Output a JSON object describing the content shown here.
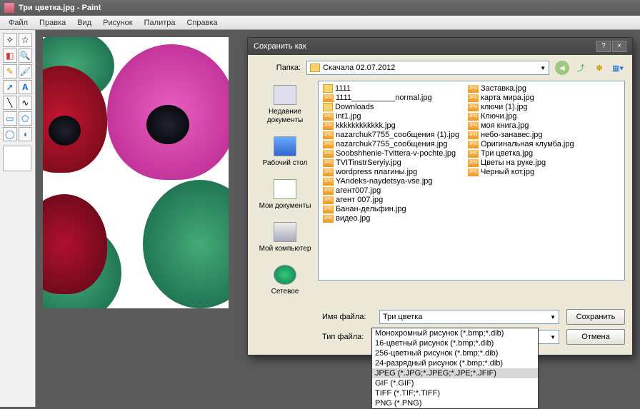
{
  "app": {
    "title": "Три цветка.jpg - Paint"
  },
  "menu": {
    "items": [
      "Файл",
      "Правка",
      "Вид",
      "Рисунок",
      "Палитра",
      "Справка"
    ]
  },
  "dialog": {
    "title": "Сохранить как",
    "help_symbol": "?",
    "close_symbol": "×",
    "folder_label": "Папка:",
    "folder_value": "Скачала 02.07.2012",
    "places": {
      "recent": "Недавние документы",
      "desktop": "Рабочий стол",
      "docs": "Мои документы",
      "computer": "Мой компьютер",
      "network": "Сетевое"
    },
    "files_col1": [
      {
        "name": "1111",
        "type": "folder"
      },
      {
        "name": "1111__________normal.jpg",
        "type": "jpg"
      },
      {
        "name": "Downloads",
        "type": "folder"
      },
      {
        "name": "int1.jpg",
        "type": "jpg"
      },
      {
        "name": "kkkkkkkkkkkk.jpg",
        "type": "jpg"
      },
      {
        "name": "nazarchuk7755_сообщения (1).jpg",
        "type": "jpg"
      },
      {
        "name": "nazarchuk7755_сообщения.jpg",
        "type": "jpg"
      },
      {
        "name": "Soobshhenie-Tvittera-v-pochte.jpg",
        "type": "jpg"
      },
      {
        "name": "TVITinstrSeryiy.jpg",
        "type": "jpg"
      },
      {
        "name": "wordpress плагины.jpg",
        "type": "jpg"
      },
      {
        "name": "YAndeks-naydetsya-vse.jpg",
        "type": "jpg"
      },
      {
        "name": "агент007.jpg",
        "type": "jpg"
      },
      {
        "name": "агент 007.jpg",
        "type": "jpg"
      },
      {
        "name": "Банан-дельфин.jpg",
        "type": "jpg"
      },
      {
        "name": "видео.jpg",
        "type": "jpg"
      }
    ],
    "files_col2": [
      {
        "name": "Заставка.jpg",
        "type": "jpg"
      },
      {
        "name": "карта мира.jpg",
        "type": "jpg"
      },
      {
        "name": "ключи (1).jpg",
        "type": "jpg"
      },
      {
        "name": "Ключи.jpg",
        "type": "jpg"
      },
      {
        "name": "моя книга.jpg",
        "type": "jpg"
      },
      {
        "name": "небо-занавес.jpg",
        "type": "jpg"
      },
      {
        "name": "Оригинальная клумба.jpg",
        "type": "jpg"
      },
      {
        "name": "Три цветка.jpg",
        "type": "jpg"
      },
      {
        "name": "Цветы на руке.jpg",
        "type": "jpg"
      },
      {
        "name": "Черный кот.jpg",
        "type": "jpg"
      }
    ],
    "filename_label": "Имя файла:",
    "filename_value": "Три цветка",
    "filetype_label": "Тип файла:",
    "filetype_value": "JPEG (*.JPG;*.JPEG;*.JPE;*.JFIF)",
    "save_btn": "Сохранить",
    "cancel_btn": "Отмена",
    "type_options": [
      "Монохромный рисунок (*.bmp;*.dib)",
      "16-цветный рисунок (*.bmp;*.dib)",
      "256-цветный рисунок (*.bmp;*.dib)",
      "24-разрядный рисунок (*.bmp;*.dib)",
      "JPEG (*.JPG;*.JPEG;*.JPE;*.JFIF)",
      "GIF (*.GIF)",
      "TIFF (*.TIF;*.TIFF)",
      "PNG (*.PNG)"
    ]
  },
  "tools": {
    "r1a": "✧",
    "r1b": "☆",
    "r2a": "◧",
    "r2b": "🔍",
    "r3a": "✎",
    "r3b": "🖌",
    "r4a": "➚",
    "r4b": "A",
    "r5a": "╲",
    "r5b": "∿",
    "r6a": "▭",
    "r6b": "⬠",
    "r7a": "◯",
    "r7b": "◖"
  }
}
